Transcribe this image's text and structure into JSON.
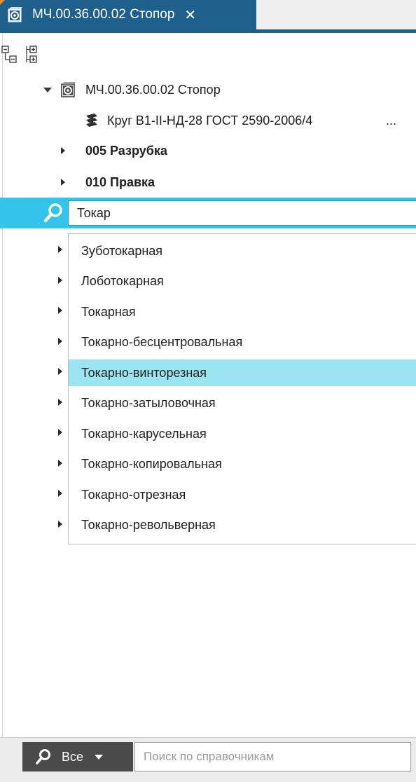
{
  "tab": {
    "title": "МЧ.00.36.00.02 Стопор",
    "close": "✕"
  },
  "toolbar": {
    "buttons": [
      {
        "icon": "collapse-tree-icon"
      },
      {
        "icon": "expand-tree-icon"
      }
    ]
  },
  "tree": {
    "root_label": "МЧ.00.36.00.02 Стопор",
    "material_label": "Круг В1-II-НД-28 ГОСТ 2590-2006/4",
    "material_ellipsis": "...",
    "op1_label": "005 Разрубка",
    "op2_label": "010 Правка"
  },
  "search": {
    "value": "Токар"
  },
  "dropdown": {
    "items": [
      "Зуботокарная",
      "Лоботокарная",
      "Токарная",
      "Токарно-бесцентровальная",
      "Токарно-винторезная",
      "Токарно-затыловочная",
      "Токарно-карусельная",
      "Токарно-копировальная",
      "Токарно-отрезная",
      "Токарно-револьверная"
    ],
    "selected_index": 4
  },
  "bottom": {
    "filter_label": "Все",
    "placeholder": "Поиск по справочникам"
  },
  "colors": {
    "accent": "#1e5f8c",
    "search_band": "#34c3ea",
    "selected_item": "#9be4f2"
  }
}
